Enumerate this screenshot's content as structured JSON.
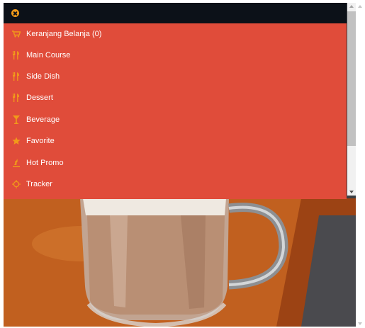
{
  "menu": {
    "items": [
      {
        "icon": "cart-icon",
        "label": "Keranjang Belanja (0)"
      },
      {
        "icon": "fork-knife-icon",
        "label": "Main Course"
      },
      {
        "icon": "fork-knife-icon",
        "label": "Side Dish"
      },
      {
        "icon": "fork-knife-icon",
        "label": "Dessert"
      },
      {
        "icon": "cocktail-glass-icon",
        "label": "Beverage"
      },
      {
        "icon": "star-icon",
        "label": "Favorite"
      },
      {
        "icon": "fire-icon",
        "label": "Hot Promo"
      },
      {
        "icon": "crosshair-icon",
        "label": "Tracker"
      }
    ]
  },
  "colors": {
    "topbar": "#0c1118",
    "menu_background": "#e04c3a",
    "icon_accent": "#f19a1a",
    "menu_text": "#ffffff"
  }
}
